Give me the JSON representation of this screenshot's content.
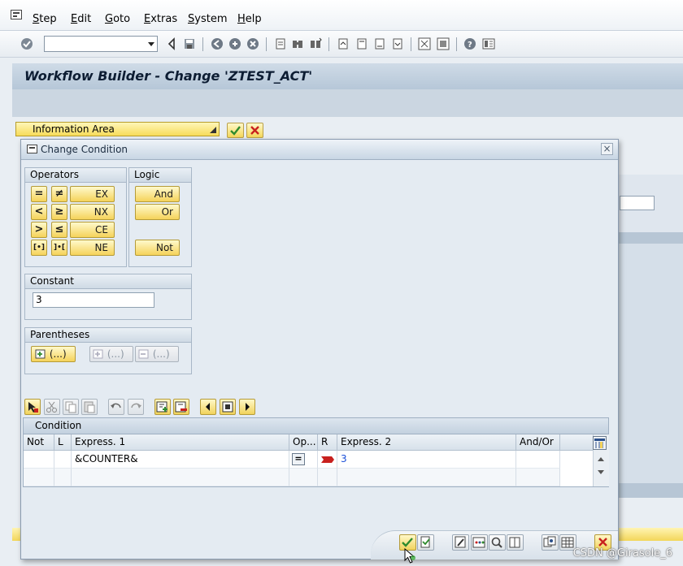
{
  "menu": {
    "items": [
      {
        "label": "Step",
        "key": "S",
        "rest": "tep"
      },
      {
        "label": "Edit",
        "key": "E",
        "rest": "dit"
      },
      {
        "label": "Goto",
        "key": "G",
        "rest": "oto"
      },
      {
        "label": "Extras",
        "key": "E",
        "rest": "xtras"
      },
      {
        "label": "System",
        "key": "S",
        "rest": "ystem"
      },
      {
        "label": "Help",
        "key": "H",
        "rest": "elp"
      }
    ]
  },
  "title": "Workflow Builder - Change 'ZTEST_ACT'",
  "info_area": {
    "label": "Information Area"
  },
  "dialog": {
    "title": "Change Condition",
    "operators": {
      "heading": "Operators",
      "buttons": [
        "EX",
        "NX",
        "CE",
        "NE"
      ],
      "symbols": [
        "=",
        "≠",
        "<",
        "≥",
        ">",
        "≤",
        "[•]",
        "]•["
      ]
    },
    "logic": {
      "heading": "Logic",
      "buttons": [
        "And",
        "Or",
        "Not"
      ]
    },
    "constant": {
      "heading": "Constant",
      "value": "3"
    },
    "parentheses": {
      "heading": "Parentheses",
      "buttons": [
        "(...)",
        "(...)",
        "(...)"
      ]
    },
    "condition_table": {
      "title": "Condition",
      "columns": [
        "Not",
        "L",
        "Express. 1",
        "Op...",
        "R",
        "Express. 2",
        "And/Or"
      ],
      "rows": [
        {
          "not": "",
          "l": "",
          "expr1": "&COUNTER&",
          "op": "=",
          "r": "",
          "expr2": "3",
          "andor": ""
        }
      ]
    }
  },
  "watermark": "CSDN @Girasole_6",
  "colors": {
    "title_bar": "#b6c7d8",
    "button_yellow": "#f5d35a",
    "confirm_green": "#2e8b2e",
    "cancel_red": "#c8201e",
    "link_blue": "#1a4fd8"
  }
}
